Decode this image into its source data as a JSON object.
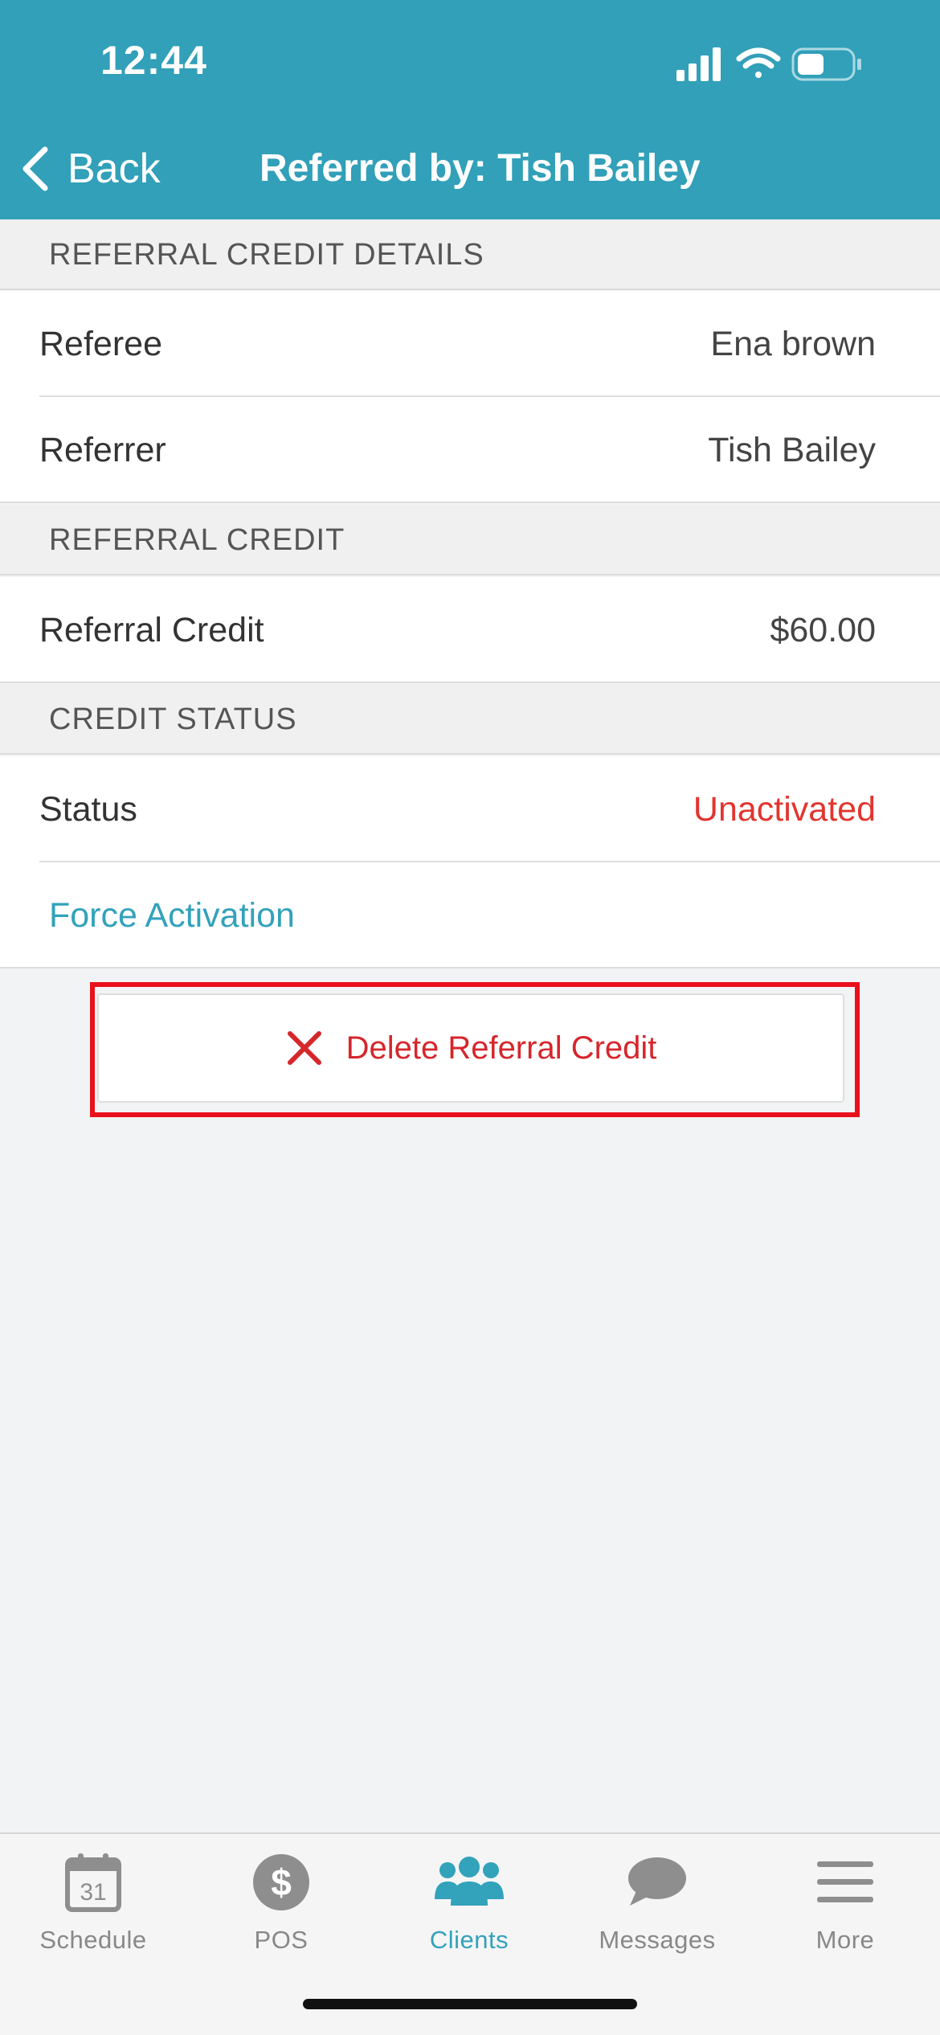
{
  "status_bar": {
    "time": "12:44"
  },
  "nav": {
    "back_label": "Back",
    "title": "Referred by: Tish Bailey"
  },
  "sections": {
    "details_header": "REFERRAL CREDIT DETAILS",
    "credit_header": "REFERRAL CREDIT",
    "status_header": "CREDIT STATUS"
  },
  "details": {
    "referee_label": "Referee",
    "referee_value": "Ena brown",
    "referrer_label": "Referrer",
    "referrer_value": "Tish Bailey"
  },
  "credit": {
    "label": "Referral Credit",
    "value": "$60.00"
  },
  "status": {
    "label": "Status",
    "value": "Unactivated",
    "value_color": "#e2352f"
  },
  "actions": {
    "force_activation": "Force Activation",
    "delete": "Delete Referral Credit"
  },
  "tabbar": {
    "items": [
      {
        "label": "Schedule",
        "icon": "calendar-icon",
        "calendar_day": "31"
      },
      {
        "label": "POS",
        "icon": "dollar-icon"
      },
      {
        "label": "Clients",
        "icon": "people-icon",
        "active": true
      },
      {
        "label": "Messages",
        "icon": "chat-bubble-icon"
      },
      {
        "label": "More",
        "icon": "menu-icon"
      }
    ]
  },
  "colors": {
    "accent": "#31a0b8",
    "danger": "#d6262c",
    "highlight": "#e8111c"
  }
}
